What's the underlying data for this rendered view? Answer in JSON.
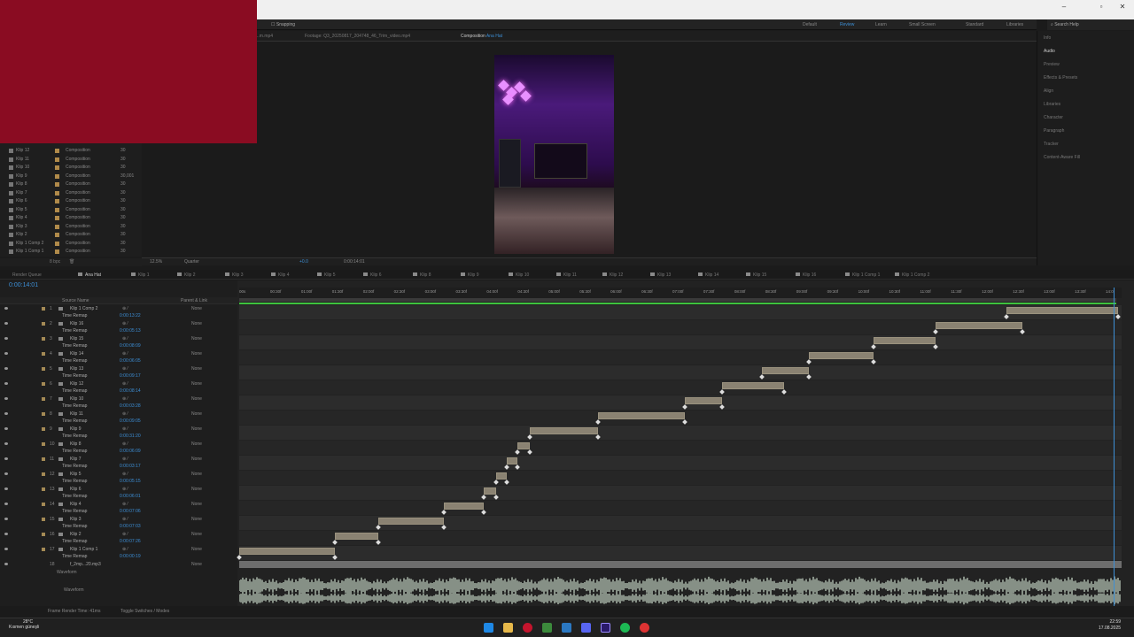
{
  "workspaces": [
    {
      "label": "Default",
      "active": false
    },
    {
      "label": "Review",
      "active": true
    },
    {
      "label": "Learn",
      "active": false
    },
    {
      "label": "Small Screen",
      "active": false
    },
    {
      "label": "Standard",
      "active": false
    },
    {
      "label": "Libraries",
      "active": false
    }
  ],
  "toolbar": {
    "snapping": "Snapping",
    "search_help": "Search Help"
  },
  "viewer_tabs": [
    {
      "label": "..m.mp4",
      "active": false
    },
    {
      "label": "Footage: Q3_20250817_204748_46_Trim_video.mp4",
      "active": false
    },
    {
      "label": "Composition",
      "highlight": "Ana Hat",
      "active": true
    }
  ],
  "viewer_footer": {
    "zoom": "12.5%",
    "resolution": "Quarter",
    "plus": "+0.0",
    "timecode": "0:00:14:01"
  },
  "project_items": [
    {
      "name": "Klip 12",
      "type": "Composition",
      "fps": "30"
    },
    {
      "name": "Klip 11",
      "type": "Composition",
      "fps": "30"
    },
    {
      "name": "Klip 10",
      "type": "Composition",
      "fps": "30"
    },
    {
      "name": "Klip 9",
      "type": "Composition",
      "fps": "30,001"
    },
    {
      "name": "Klip 8",
      "type": "Composition",
      "fps": "30"
    },
    {
      "name": "Klip 7",
      "type": "Composition",
      "fps": "30"
    },
    {
      "name": "Klip 6",
      "type": "Composition",
      "fps": "30"
    },
    {
      "name": "Klip 5",
      "type": "Composition",
      "fps": "30"
    },
    {
      "name": "Klip 4",
      "type": "Composition",
      "fps": "30"
    },
    {
      "name": "Klip 3",
      "type": "Composition",
      "fps": "30"
    },
    {
      "name": "Klip 2",
      "type": "Composition",
      "fps": "30"
    },
    {
      "name": "Klip 1 Comp 2",
      "type": "Composition",
      "fps": "30"
    },
    {
      "name": "Klip 1 Comp 1",
      "type": "Composition",
      "fps": "30"
    }
  ],
  "project_footer": {
    "bpc": "8 bpc"
  },
  "right_panel": [
    {
      "label": "Info",
      "active": false
    },
    {
      "label": "Audio",
      "active": true
    },
    {
      "label": "Preview",
      "active": false
    },
    {
      "label": "Effects & Presets",
      "active": false
    },
    {
      "label": "Align",
      "active": false
    },
    {
      "label": "Libraries",
      "active": false
    },
    {
      "label": "Character",
      "active": false
    },
    {
      "label": "Paragraph",
      "active": false
    },
    {
      "label": "Tracker",
      "active": false
    },
    {
      "label": "Content-Aware Fill",
      "active": false
    }
  ],
  "timeline_tabs": [
    {
      "label": "Render Queue",
      "active": false
    },
    {
      "label": "Ana Hat",
      "active": true
    },
    {
      "label": "Klip 1",
      "active": false
    },
    {
      "label": "Klip 2",
      "active": false
    },
    {
      "label": "Klip 3",
      "active": false
    },
    {
      "label": "Klip 4",
      "active": false
    },
    {
      "label": "Klip 5",
      "active": false
    },
    {
      "label": "Klip 6",
      "active": false
    },
    {
      "label": "Klip 8",
      "active": false
    },
    {
      "label": "Klip 9",
      "active": false
    },
    {
      "label": "Klip 10",
      "active": false
    },
    {
      "label": "Klip 11",
      "active": false
    },
    {
      "label": "Klip 12",
      "active": false
    },
    {
      "label": "Klip 13",
      "active": false
    },
    {
      "label": "Klip 14",
      "active": false
    },
    {
      "label": "Klip 15",
      "active": false
    },
    {
      "label": "Klip 16",
      "active": false
    },
    {
      "label": "Klip 1 Comp 1",
      "active": false
    },
    {
      "label": "Klip 1 Comp 2",
      "active": false
    }
  ],
  "timeline": {
    "timecode": "0:00:14:01",
    "col_source": "Source Name",
    "col_parent": "Parent & Link",
    "time_remap": "Time Remap",
    "waveform": "Waveform",
    "ruler": [
      "00s",
      "00:30f",
      "01:00f",
      "01:30f",
      "02:00f",
      "02:30f",
      "03:00f",
      "03:30f",
      "04:00f",
      "04:30f",
      "05:00f",
      "05:30f",
      "06:00f",
      "06:30f",
      "07:00f",
      "07:30f",
      "08:00f",
      "08:30f",
      "09:00f",
      "09:30f",
      "10:00f",
      "10:30f",
      "11:00f",
      "11:30f",
      "12:00f",
      "12:30f",
      "13:00f",
      "13:30f",
      "14:0"
    ],
    "footer_render": "Frame Render Time: 41ms",
    "footer_toggle": "Toggle Switches / Modes"
  },
  "layers": [
    {
      "num": "1",
      "name": "Klip 1 Comp 2",
      "remap": "0:00:13:22",
      "parent": "None",
      "start": 12.4,
      "end": 14.2
    },
    {
      "num": "2",
      "name": "Klip 16",
      "remap": "0:00:05:13",
      "parent": "None",
      "start": 11.25,
      "end": 12.65
    },
    {
      "num": "3",
      "name": "Klip 15",
      "remap": "0:00:08:09",
      "parent": "None",
      "start": 10.25,
      "end": 11.25
    },
    {
      "num": "4",
      "name": "Klip 14",
      "remap": "0:00:06:05",
      "parent": "None",
      "start": 9.2,
      "end": 10.25
    },
    {
      "num": "5",
      "name": "Klip 13",
      "remap": "0:00:09:17",
      "parent": "None",
      "start": 8.45,
      "end": 9.2
    },
    {
      "num": "6",
      "name": "Klip 12",
      "remap": "0:00:08:14",
      "parent": "None",
      "start": 7.8,
      "end": 8.8
    },
    {
      "num": "7",
      "name": "Klip 10",
      "remap": "0:00:03:28",
      "parent": "None",
      "start": 7.2,
      "end": 7.8
    },
    {
      "num": "8",
      "name": "Klip 11",
      "remap": "0:00:09:05",
      "parent": "None",
      "start": 5.8,
      "end": 7.2
    },
    {
      "num": "9",
      "name": "Klip 9",
      "remap": "0:00:31:20",
      "parent": "None",
      "start": 4.7,
      "end": 5.8
    },
    {
      "num": "10",
      "name": "Klip 8",
      "remap": "0:00:06:09",
      "parent": "None",
      "start": 4.5,
      "end": 4.7
    },
    {
      "num": "11",
      "name": "Klip 7",
      "remap": "0:00:03:17",
      "parent": "None",
      "start": 4.32,
      "end": 4.5
    },
    {
      "num": "12",
      "name": "Klip 5",
      "remap": "0:00:05:15",
      "parent": "None",
      "start": 4.15,
      "end": 4.32
    },
    {
      "num": "13",
      "name": "Klip 6",
      "remap": "0:00:06:01",
      "parent": "None",
      "start": 3.95,
      "end": 4.15
    },
    {
      "num": "14",
      "name": "Klip 4",
      "remap": "0:00:07:06",
      "parent": "None",
      "start": 3.3,
      "end": 3.95
    },
    {
      "num": "15",
      "name": "Klip 3",
      "remap": "0:00:07:03",
      "parent": "None",
      "start": 2.25,
      "end": 3.3
    },
    {
      "num": "16",
      "name": "Klip 2",
      "remap": "0:00:07:26",
      "parent": "None",
      "start": 1.55,
      "end": 2.25
    },
    {
      "num": "17",
      "name": "Klip 1 Comp 1",
      "remap": "0:00:00:19",
      "parent": "None",
      "start": 0.0,
      "end": 1.55
    }
  ],
  "audio_layer": {
    "num": "18",
    "name": "f_2mp...20.mp3",
    "parent": "None"
  },
  "taskbar": {
    "temp": "28°C",
    "weather": "Kısmen güneşli",
    "time": "22:59",
    "date": "17.08.2025"
  },
  "colors": {
    "accent": "#3d8fd6",
    "green": "#3ec23e",
    "clip": "#8a8272",
    "taskbar": "#202020"
  }
}
